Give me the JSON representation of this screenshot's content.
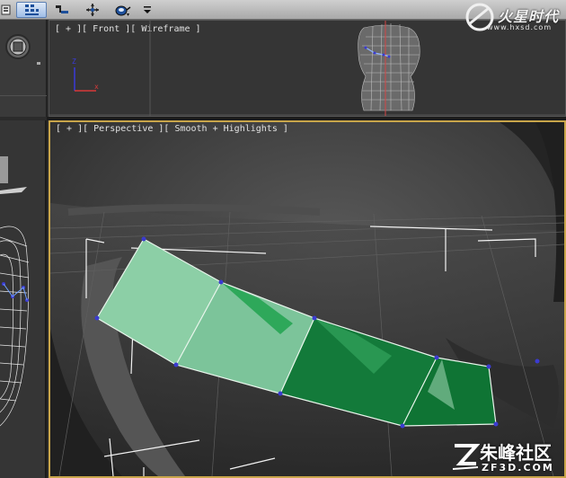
{
  "toolbar": {
    "buttons": [
      {
        "icon": "layer-icon"
      },
      {
        "icon": "schematic-grid-icon",
        "active": true
      },
      {
        "icon": "link-icon"
      },
      {
        "icon": "move-transform-icon"
      },
      {
        "icon": "render-teapot-icon"
      },
      {
        "icon": "dropdown-arrow-icon"
      }
    ]
  },
  "watermark_top": {
    "brand": "火星时代",
    "url": "www.hxsd.com"
  },
  "viewport_front": {
    "label": "[ + ][ Front ][ Wireframe ]",
    "axis_z": "Z"
  },
  "viewport_perspective": {
    "label": "[ + ][ Perspective ][ Smooth + Highlights ]"
  },
  "watermark_bottom": {
    "zh": "朱峰社区",
    "en": "ZF3D.COM"
  },
  "colors": {
    "selection_light": "#8cd0a8",
    "selection_dark": "#127a3a",
    "viewport_border": "#c8a54a",
    "vertex": "#3b3bd0"
  }
}
